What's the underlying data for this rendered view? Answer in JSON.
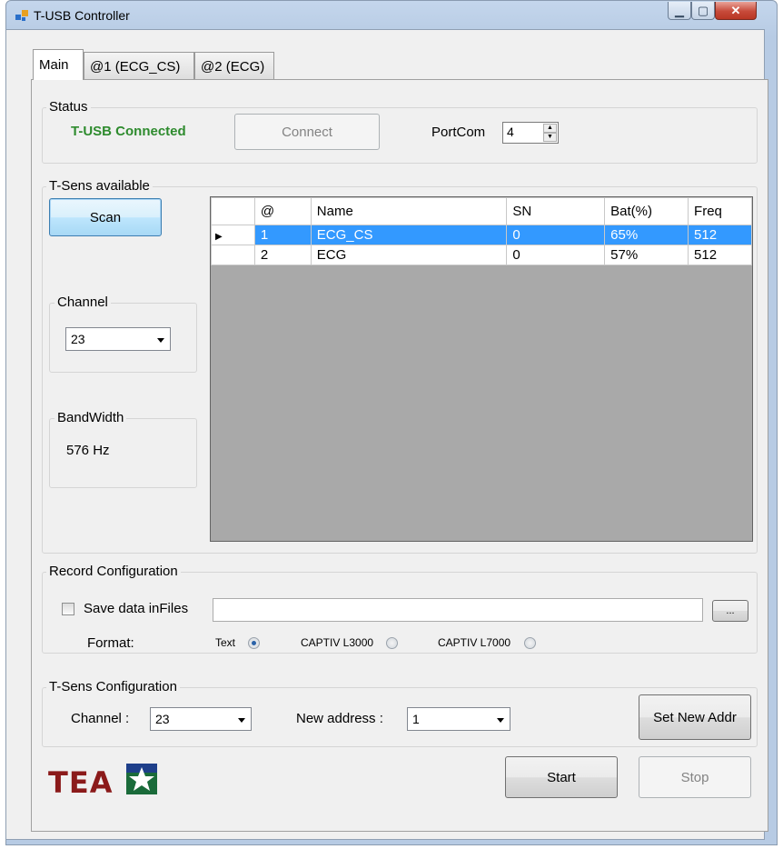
{
  "window": {
    "title": "T-USB Controller"
  },
  "tabs": [
    {
      "label": "Main"
    },
    {
      "label": "@1 (ECG_CS)"
    },
    {
      "label": "@2 (ECG)"
    }
  ],
  "status": {
    "group_label": "Status",
    "connection_text": "T-USB Connected",
    "connection_color": "#2e8b2e",
    "connect_label": "Connect",
    "portcom_label": "PortCom",
    "portcom_value": "4"
  },
  "tsens_available": {
    "group_label": "T-Sens available",
    "scan_label": "Scan",
    "channel_group_label": "Channel",
    "channel_value": "23",
    "bandwidth_group_label": "BandWidth",
    "bandwidth_value": "576 Hz",
    "columns": [
      "@",
      "Name",
      "SN",
      "Bat(%)",
      "Freq"
    ],
    "rows": [
      {
        "addr": "1",
        "name": "ECG_CS",
        "sn": "0",
        "bat": "65%",
        "freq": "512",
        "selected": true
      },
      {
        "addr": "2",
        "name": "ECG",
        "sn": "0",
        "bat": "57%",
        "freq": "512",
        "selected": false
      }
    ]
  },
  "record": {
    "group_label": "Record Configuration",
    "save_label": "Save data inFiles",
    "save_checked": false,
    "file_path": "",
    "browse_label": "...",
    "format_label": "Format:",
    "formats": [
      {
        "label": "Text",
        "selected": true
      },
      {
        "label": "CAPTIV L3000",
        "selected": false
      },
      {
        "label": "CAPTIV L7000",
        "selected": false
      }
    ]
  },
  "tsens_config": {
    "group_label": "T-Sens Configuration",
    "channel_label": "Channel :",
    "channel_value": "23",
    "new_address_label": "New address :",
    "new_address_value": "1",
    "set_addr_label": "Set New Addr"
  },
  "footer": {
    "logo_text": "TEA",
    "start_label": "Start",
    "stop_label": "Stop"
  },
  "colors": {
    "selection": "#3399ff",
    "grid_bg": "#a9a9a9"
  }
}
